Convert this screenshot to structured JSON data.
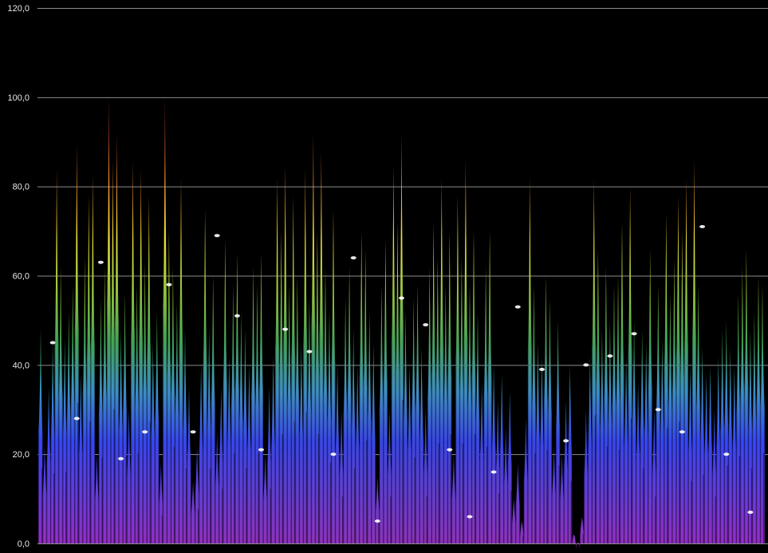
{
  "chart_data": {
    "type": "area",
    "title": "",
    "xlabel": "",
    "ylabel": "",
    "ylim": [
      0,
      120
    ],
    "y_ticks": [
      "0,0",
      "20,0",
      "40,0",
      "60,0",
      "80,0",
      "100,0",
      "120,0"
    ],
    "grid": "horizontal",
    "legend": "none",
    "colors": {
      "background": "#000000",
      "grid": "#8c8c8c",
      "tick_text": "#e8e8e8",
      "gradient": [
        "#8a10c8",
        "#5020e0",
        "#1a2cff",
        "#1f86c8",
        "#2aa040",
        "#8ec820",
        "#f0e020",
        "#ff9a10",
        "#e84a10",
        "#c01848"
      ]
    },
    "x": [
      0,
      1,
      2,
      3,
      4,
      5,
      6,
      7,
      8,
      9,
      10,
      11,
      12,
      13,
      14,
      15,
      16,
      17,
      18,
      19,
      20,
      21,
      22,
      23,
      24,
      25,
      26,
      27,
      28,
      29,
      30,
      31,
      32,
      33,
      34,
      35,
      36,
      37,
      38,
      39,
      40,
      41,
      42,
      43,
      44,
      45,
      46,
      47,
      48,
      49,
      50,
      51,
      52,
      53,
      54,
      55,
      56,
      57,
      58,
      59,
      60,
      61,
      62,
      63,
      64,
      65,
      66,
      67,
      68,
      69,
      70,
      71,
      72,
      73,
      74,
      75,
      76,
      77,
      78,
      79,
      80,
      81,
      82,
      83,
      84,
      85,
      86,
      87,
      88,
      89,
      90,
      91,
      92,
      93,
      94,
      95,
      96,
      97,
      98,
      99,
      100,
      101,
      102,
      103,
      104,
      105,
      106,
      107,
      108,
      109,
      110,
      111,
      112,
      113,
      114,
      115,
      116,
      117,
      118,
      119,
      120,
      121,
      122,
      123,
      124,
      125,
      126,
      127,
      128,
      129,
      130,
      131,
      132,
      133,
      134,
      135,
      136,
      137,
      138,
      139,
      140,
      141,
      142,
      143,
      144,
      145,
      146,
      147,
      148,
      149,
      150,
      151,
      152,
      153,
      154,
      155,
      156,
      157,
      158,
      159,
      160,
      161,
      162,
      163,
      164,
      165,
      166,
      167,
      168,
      169,
      170,
      171,
      172,
      173,
      174,
      175,
      176,
      177,
      178,
      179,
      180
    ],
    "values": [
      48,
      22,
      35,
      45,
      84,
      62,
      46,
      52,
      58,
      90,
      38,
      64,
      78,
      83,
      20,
      55,
      62,
      100,
      86,
      92,
      48,
      56,
      30,
      86,
      58,
      84,
      63,
      78,
      45,
      52,
      18,
      100,
      70,
      62,
      54,
      82,
      48,
      35,
      14,
      22,
      40,
      75,
      48,
      60,
      25,
      35,
      68,
      42,
      58,
      65,
      52,
      48,
      40,
      62,
      58,
      65,
      20,
      35,
      42,
      82,
      70,
      85,
      58,
      78,
      60,
      45,
      84,
      55,
      92,
      70,
      88,
      62,
      52,
      75,
      40,
      30,
      55,
      62,
      48,
      40,
      70,
      66,
      52,
      45,
      15,
      58,
      68,
      30,
      85,
      72,
      92,
      52,
      40,
      55,
      58,
      44,
      30,
      62,
      72,
      64,
      82,
      58,
      70,
      20,
      78,
      64,
      86,
      58,
      70,
      52,
      36,
      62,
      70,
      40,
      32,
      38,
      26,
      34,
      10,
      18,
      5,
      28,
      82,
      58,
      45,
      42,
      60,
      55,
      22,
      50,
      20,
      32,
      40,
      2,
      0,
      6,
      30,
      42,
      82,
      66,
      48,
      62,
      50,
      58,
      60,
      72,
      42,
      80,
      50,
      36,
      48,
      45,
      66,
      30,
      58,
      46,
      74,
      56,
      64,
      78,
      70,
      82,
      40,
      86,
      58,
      44,
      38,
      40,
      30,
      42,
      48,
      50,
      44,
      40,
      56,
      62,
      66,
      48,
      52,
      60,
      58
    ],
    "marker_values": [
      45,
      28,
      63,
      19,
      25,
      58,
      25,
      69,
      51,
      21,
      48,
      43,
      20,
      64,
      5,
      55,
      49,
      21,
      6,
      16,
      53,
      39,
      23,
      40,
      42,
      47,
      30,
      25,
      71,
      20,
      7
    ]
  }
}
